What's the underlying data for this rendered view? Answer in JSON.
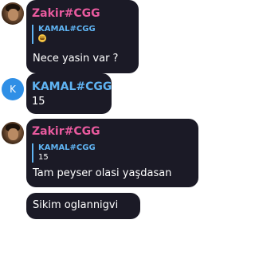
{
  "messages": [
    {
      "sender": "Zakir#CGG",
      "avatar": "user-photo",
      "reply": {
        "name": "KAMAL#CGG",
        "text": "😄"
      },
      "text": "Nece yasin var ?"
    },
    {
      "sender": "KAMAL#CGG",
      "avatar_letter": "K",
      "text": "15"
    },
    {
      "sender": "Zakir#CGG",
      "avatar": "user-photo",
      "reply": {
        "name": "KAMAL#CGG",
        "text": "15"
      },
      "text": "Tam peyser olasi yaşdasan"
    },
    {
      "text": "Sikim oglannigvi"
    }
  ],
  "colors": {
    "bubble": "#1b1a26",
    "sender_pink": "#e85a9e",
    "sender_blue": "#5fb3f2",
    "avatar_k": "#2f8fe6"
  }
}
